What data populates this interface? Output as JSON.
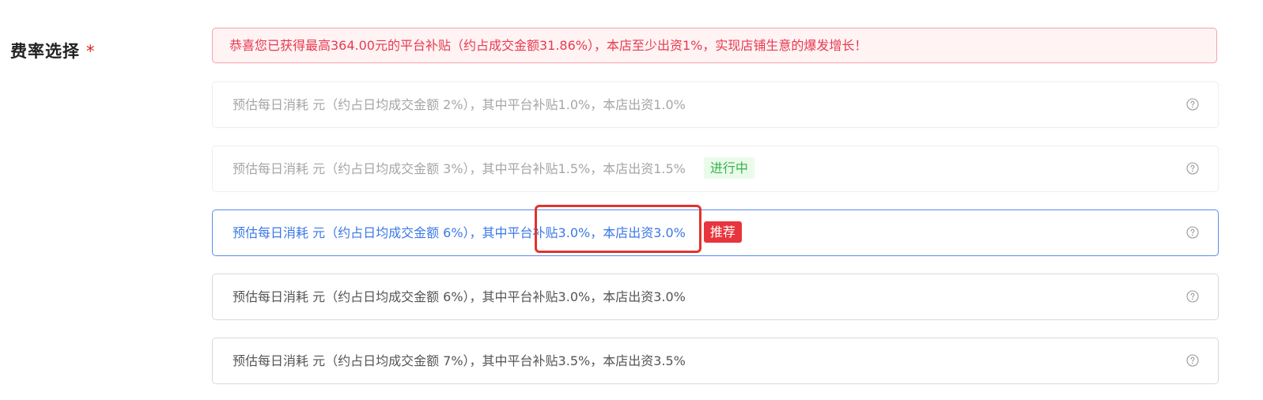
{
  "form": {
    "label": "费率选择",
    "required_mark": "*"
  },
  "banner": {
    "text": "恭喜您已获得最高364.00元的平台补贴（约占成交金额31.86%），本店至少出资1%，实现店铺生意的爆发增长！"
  },
  "options": [
    {
      "text": "预估每日消耗 元（约占日均成交金额 2%），其中平台补贴1.0%，本店出资1.0%",
      "state": "disabled",
      "tag": null
    },
    {
      "text": "预估每日消耗 元（约占日均成交金额 3%），其中平台补贴1.5%，本店出资1.5%",
      "state": "disabled",
      "tag": "进行中"
    },
    {
      "text": "预估每日消耗 元（约占日均成交金额 6%），其中平台补贴3.0%，本店出资3.0%",
      "state": "selected",
      "tag": "推荐"
    },
    {
      "text": "预估每日消耗 元（约占日均成交金额 6%），其中平台补贴3.0%，本店出资3.0%",
      "state": "normal",
      "tag": null
    },
    {
      "text": "预估每日消耗 元（约占日均成交金额 7%），其中平台补贴3.5%，本店出资3.5%",
      "state": "normal",
      "tag": null
    }
  ],
  "icons": {
    "help": "help-circle-icon"
  },
  "colors": {
    "banner_text": "#e83a4e",
    "banner_border": "#f5a3ab",
    "selected_border": "#5a8dee",
    "selected_text": "#3b78e7",
    "tag_progress_text": "#36b24a",
    "tag_recommend_bg": "#e8343c",
    "highlight_box": "#e0342b"
  }
}
